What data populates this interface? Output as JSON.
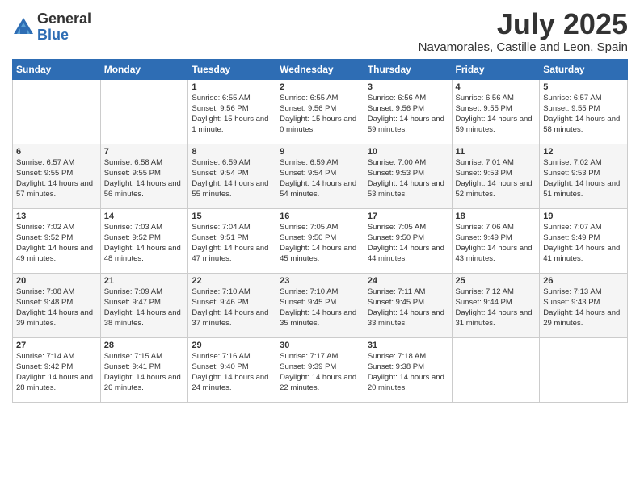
{
  "logo": {
    "general": "General",
    "blue": "Blue"
  },
  "title": "July 2025",
  "subtitle": "Navamorales, Castille and Leon, Spain",
  "days_of_week": [
    "Sunday",
    "Monday",
    "Tuesday",
    "Wednesday",
    "Thursday",
    "Friday",
    "Saturday"
  ],
  "weeks": [
    [
      {
        "day": "",
        "info": ""
      },
      {
        "day": "",
        "info": ""
      },
      {
        "day": "1",
        "info": "Sunrise: 6:55 AM\nSunset: 9:56 PM\nDaylight: 15 hours and 1 minute."
      },
      {
        "day": "2",
        "info": "Sunrise: 6:55 AM\nSunset: 9:56 PM\nDaylight: 15 hours and 0 minutes."
      },
      {
        "day": "3",
        "info": "Sunrise: 6:56 AM\nSunset: 9:56 PM\nDaylight: 14 hours and 59 minutes."
      },
      {
        "day": "4",
        "info": "Sunrise: 6:56 AM\nSunset: 9:55 PM\nDaylight: 14 hours and 59 minutes."
      },
      {
        "day": "5",
        "info": "Sunrise: 6:57 AM\nSunset: 9:55 PM\nDaylight: 14 hours and 58 minutes."
      }
    ],
    [
      {
        "day": "6",
        "info": "Sunrise: 6:57 AM\nSunset: 9:55 PM\nDaylight: 14 hours and 57 minutes."
      },
      {
        "day": "7",
        "info": "Sunrise: 6:58 AM\nSunset: 9:55 PM\nDaylight: 14 hours and 56 minutes."
      },
      {
        "day": "8",
        "info": "Sunrise: 6:59 AM\nSunset: 9:54 PM\nDaylight: 14 hours and 55 minutes."
      },
      {
        "day": "9",
        "info": "Sunrise: 6:59 AM\nSunset: 9:54 PM\nDaylight: 14 hours and 54 minutes."
      },
      {
        "day": "10",
        "info": "Sunrise: 7:00 AM\nSunset: 9:53 PM\nDaylight: 14 hours and 53 minutes."
      },
      {
        "day": "11",
        "info": "Sunrise: 7:01 AM\nSunset: 9:53 PM\nDaylight: 14 hours and 52 minutes."
      },
      {
        "day": "12",
        "info": "Sunrise: 7:02 AM\nSunset: 9:53 PM\nDaylight: 14 hours and 51 minutes."
      }
    ],
    [
      {
        "day": "13",
        "info": "Sunrise: 7:02 AM\nSunset: 9:52 PM\nDaylight: 14 hours and 49 minutes."
      },
      {
        "day": "14",
        "info": "Sunrise: 7:03 AM\nSunset: 9:52 PM\nDaylight: 14 hours and 48 minutes."
      },
      {
        "day": "15",
        "info": "Sunrise: 7:04 AM\nSunset: 9:51 PM\nDaylight: 14 hours and 47 minutes."
      },
      {
        "day": "16",
        "info": "Sunrise: 7:05 AM\nSunset: 9:50 PM\nDaylight: 14 hours and 45 minutes."
      },
      {
        "day": "17",
        "info": "Sunrise: 7:05 AM\nSunset: 9:50 PM\nDaylight: 14 hours and 44 minutes."
      },
      {
        "day": "18",
        "info": "Sunrise: 7:06 AM\nSunset: 9:49 PM\nDaylight: 14 hours and 43 minutes."
      },
      {
        "day": "19",
        "info": "Sunrise: 7:07 AM\nSunset: 9:49 PM\nDaylight: 14 hours and 41 minutes."
      }
    ],
    [
      {
        "day": "20",
        "info": "Sunrise: 7:08 AM\nSunset: 9:48 PM\nDaylight: 14 hours and 39 minutes."
      },
      {
        "day": "21",
        "info": "Sunrise: 7:09 AM\nSunset: 9:47 PM\nDaylight: 14 hours and 38 minutes."
      },
      {
        "day": "22",
        "info": "Sunrise: 7:10 AM\nSunset: 9:46 PM\nDaylight: 14 hours and 37 minutes."
      },
      {
        "day": "23",
        "info": "Sunrise: 7:10 AM\nSunset: 9:45 PM\nDaylight: 14 hours and 35 minutes."
      },
      {
        "day": "24",
        "info": "Sunrise: 7:11 AM\nSunset: 9:45 PM\nDaylight: 14 hours and 33 minutes."
      },
      {
        "day": "25",
        "info": "Sunrise: 7:12 AM\nSunset: 9:44 PM\nDaylight: 14 hours and 31 minutes."
      },
      {
        "day": "26",
        "info": "Sunrise: 7:13 AM\nSunset: 9:43 PM\nDaylight: 14 hours and 29 minutes."
      }
    ],
    [
      {
        "day": "27",
        "info": "Sunrise: 7:14 AM\nSunset: 9:42 PM\nDaylight: 14 hours and 28 minutes."
      },
      {
        "day": "28",
        "info": "Sunrise: 7:15 AM\nSunset: 9:41 PM\nDaylight: 14 hours and 26 minutes."
      },
      {
        "day": "29",
        "info": "Sunrise: 7:16 AM\nSunset: 9:40 PM\nDaylight: 14 hours and 24 minutes."
      },
      {
        "day": "30",
        "info": "Sunrise: 7:17 AM\nSunset: 9:39 PM\nDaylight: 14 hours and 22 minutes."
      },
      {
        "day": "31",
        "info": "Sunrise: 7:18 AM\nSunset: 9:38 PM\nDaylight: 14 hours and 20 minutes."
      },
      {
        "day": "",
        "info": ""
      },
      {
        "day": "",
        "info": ""
      }
    ]
  ]
}
